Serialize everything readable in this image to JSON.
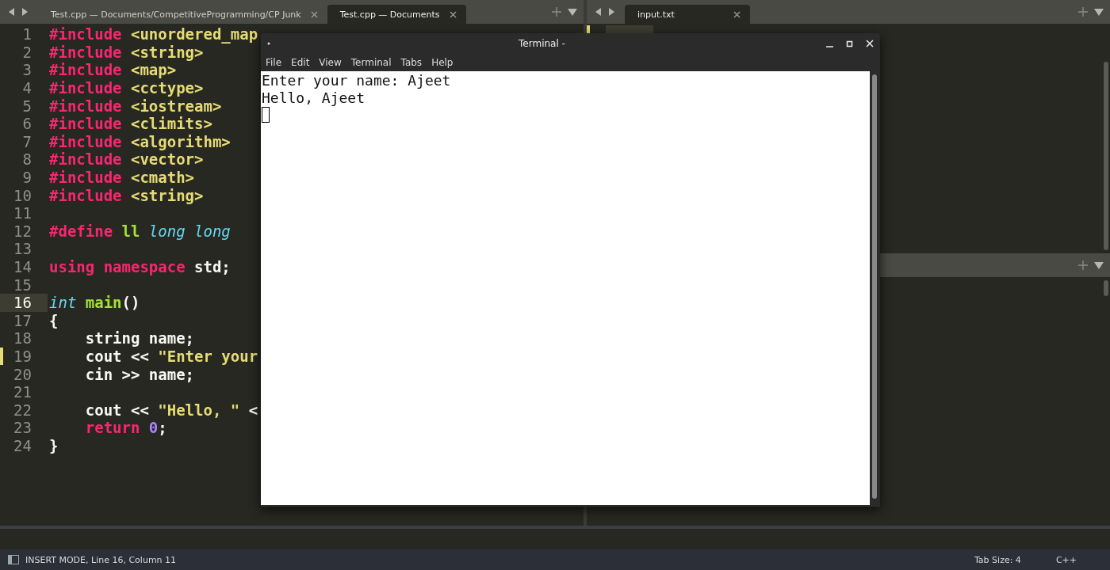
{
  "left_pane": {
    "tabs": [
      {
        "label": "Test.cpp — Documents/CompetitiveProgramming/CP Junk",
        "selected": false
      },
      {
        "label": "Test.cpp — Documents",
        "selected": true
      }
    ],
    "lines": [
      {
        "number": "1",
        "current": false,
        "modified": false,
        "tokens": [
          {
            "kind": "pre",
            "text": "#include"
          },
          {
            "kind": "str",
            "text": " <unordered_map"
          }
        ]
      },
      {
        "number": "2",
        "current": false,
        "modified": false,
        "tokens": [
          {
            "kind": "pre",
            "text": "#include"
          },
          {
            "kind": "str",
            "text": " <string>"
          }
        ]
      },
      {
        "number": "3",
        "current": false,
        "modified": false,
        "tokens": [
          {
            "kind": "pre",
            "text": "#include"
          },
          {
            "kind": "str",
            "text": " <map>"
          }
        ]
      },
      {
        "number": "4",
        "current": false,
        "modified": false,
        "tokens": [
          {
            "kind": "pre",
            "text": "#include"
          },
          {
            "kind": "str",
            "text": " <cctype>"
          }
        ]
      },
      {
        "number": "5",
        "current": false,
        "modified": false,
        "tokens": [
          {
            "kind": "pre",
            "text": "#include"
          },
          {
            "kind": "str",
            "text": " <iostream>"
          }
        ]
      },
      {
        "number": "6",
        "current": false,
        "modified": false,
        "tokens": [
          {
            "kind": "pre",
            "text": "#include"
          },
          {
            "kind": "str",
            "text": " <climits>"
          }
        ]
      },
      {
        "number": "7",
        "current": false,
        "modified": false,
        "tokens": [
          {
            "kind": "pre",
            "text": "#include"
          },
          {
            "kind": "str",
            "text": " <algorithm>"
          }
        ]
      },
      {
        "number": "8",
        "current": false,
        "modified": false,
        "tokens": [
          {
            "kind": "pre",
            "text": "#include"
          },
          {
            "kind": "str",
            "text": " <vector>"
          }
        ]
      },
      {
        "number": "9",
        "current": false,
        "modified": false,
        "tokens": [
          {
            "kind": "pre",
            "text": "#include"
          },
          {
            "kind": "str",
            "text": " <cmath>"
          }
        ]
      },
      {
        "number": "10",
        "current": false,
        "modified": false,
        "tokens": [
          {
            "kind": "pre",
            "text": "#include"
          },
          {
            "kind": "str",
            "text": " <string>"
          }
        ]
      },
      {
        "number": "11",
        "current": false,
        "modified": false
      },
      {
        "number": "12",
        "current": false,
        "modified": false,
        "tokens": [
          {
            "kind": "pre",
            "text": "#define"
          },
          {
            "kind": "func",
            "text": " ll"
          },
          {
            "kind": "type",
            "text": " long long"
          }
        ]
      },
      {
        "number": "13",
        "current": false,
        "modified": false
      },
      {
        "number": "14",
        "current": false,
        "modified": false,
        "tokens": [
          {
            "kind": "pre",
            "text": "using namespace"
          },
          {
            "kind": "plain",
            "text": " std;"
          }
        ]
      },
      {
        "number": "15",
        "current": false,
        "modified": false
      },
      {
        "number": "16",
        "current": true,
        "modified": false,
        "tokens": [
          {
            "kind": "type",
            "text": "int"
          },
          {
            "kind": "func",
            "text": " main"
          },
          {
            "kind": "plain",
            "text": "()"
          }
        ]
      },
      {
        "number": "17",
        "current": false,
        "modified": false,
        "tokens": [
          {
            "kind": "plain",
            "text": "{"
          }
        ]
      },
      {
        "number": "18",
        "current": false,
        "modified": false,
        "tokens": [
          {
            "kind": "plain",
            "text": "    string name;"
          }
        ]
      },
      {
        "number": "19",
        "current": false,
        "modified": true,
        "tokens": [
          {
            "kind": "plain",
            "text": "    cout <<"
          },
          {
            "kind": "str",
            "text": " \"Enter your"
          }
        ]
      },
      {
        "number": "20",
        "current": false,
        "modified": false,
        "tokens": [
          {
            "kind": "plain",
            "text": "    cin >> name;"
          }
        ]
      },
      {
        "number": "21",
        "current": false,
        "modified": false
      },
      {
        "number": "22",
        "current": false,
        "modified": false,
        "tokens": [
          {
            "kind": "plain",
            "text": "    cout <<"
          },
          {
            "kind": "str",
            "text": " \"Hello, \""
          },
          {
            "kind": "plain",
            "text": " <"
          }
        ]
      },
      {
        "number": "23",
        "current": false,
        "modified": false,
        "tokens": [
          {
            "kind": "pre",
            "text": "    return"
          },
          {
            "kind": "num",
            "text": " 0"
          },
          {
            "kind": "plain",
            "text": ";"
          }
        ]
      },
      {
        "number": "24",
        "current": false,
        "modified": false,
        "tokens": [
          {
            "kind": "plain",
            "text": "}"
          }
        ]
      }
    ]
  },
  "right_pane": {
    "tabs": [
      {
        "label": "input.txt",
        "selected": true
      }
    ]
  },
  "terminal": {
    "title": "Terminal -",
    "menu": [
      "File",
      "Edit",
      "View",
      "Terminal",
      "Tabs",
      "Help"
    ],
    "output": [
      "Enter your name: Ajeet",
      "Hello, Ajeet"
    ]
  },
  "status_bar": {
    "mode": "INSERT MODE, Line 16, Column 11",
    "tab_size": "Tab Size: 4",
    "syntax": "C++"
  }
}
